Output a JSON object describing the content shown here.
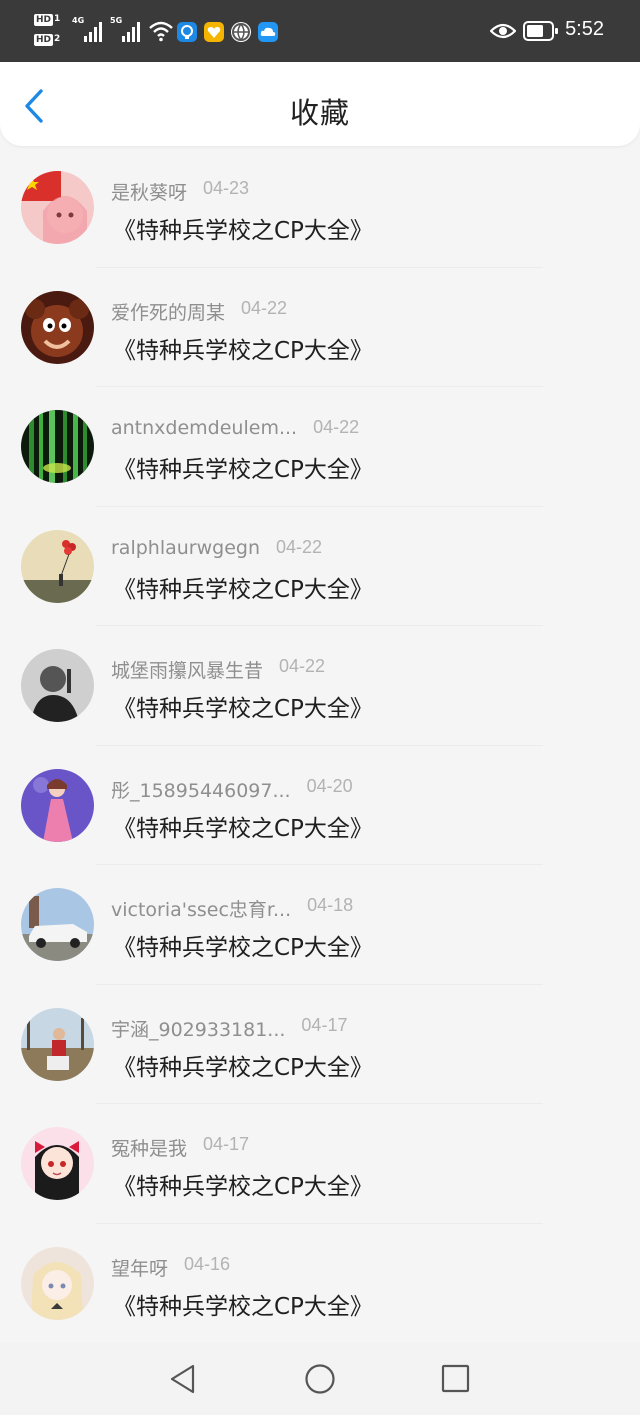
{
  "status_bar": {
    "time": "5:52",
    "sim1_badge": "HD",
    "sim1_num": "1",
    "sim2_badge": "HD",
    "sim2_num": "2",
    "net1_label": "4G",
    "net2_label": "5G",
    "icons": [
      "signal-4g-icon",
      "signal-5g-icon",
      "wifi-icon",
      "bulb-app-icon",
      "heart-app-icon",
      "globe-app-icon",
      "cloud-app-icon",
      "eye-icon",
      "battery-icon"
    ],
    "app_colors": {
      "bulb": "#1e88e5",
      "heart": "#f4b400",
      "globe": "#555555",
      "cloud": "#2196f3"
    }
  },
  "header": {
    "title": "收藏",
    "back_icon": "chevron-left-icon",
    "accent": "#1e88e5"
  },
  "favorites": [
    {
      "user": "是秋葵呀",
      "date": "04-23",
      "title": "《特种兵学校之CP大全》",
      "avatar": "avatar-anime-flag"
    },
    {
      "user": "爱作死的周某",
      "date": "04-22",
      "title": "《特种兵学校之CP大全》",
      "avatar": "avatar-cartoon-mouse"
    },
    {
      "user": "antnxdemdeulem...",
      "date": "04-22",
      "title": "《特种兵学校之CP大全》",
      "avatar": "avatar-green-bamboo"
    },
    {
      "user": "ralphlaurwgegn",
      "date": "04-22",
      "title": "《特种兵学校之CP大全》",
      "avatar": "avatar-balloons"
    },
    {
      "user": "城堡雨攥风暴生昔",
      "date": "04-22",
      "title": "《特种兵学校之CP大全》",
      "avatar": "avatar-man-bw"
    },
    {
      "user": "彤_15895446097...",
      "date": "04-20",
      "title": "《特种兵学校之CP大全》",
      "avatar": "avatar-pink-dress"
    },
    {
      "user": "victoria'ssec忠育r...",
      "date": "04-18",
      "title": "《特种兵学校之CP大全》",
      "avatar": "avatar-white-car"
    },
    {
      "user": "宇涵_902933181...",
      "date": "04-17",
      "title": "《特种兵学校之CP大全》",
      "avatar": "avatar-outdoor-person"
    },
    {
      "user": "冤种是我",
      "date": "04-17",
      "title": "《特种兵学校之CP大全》",
      "avatar": "avatar-anime-girl"
    },
    {
      "user": "望年呀",
      "date": "04-16",
      "title": "《特种兵学校之CP大全》",
      "avatar": "avatar-pale-anime"
    }
  ],
  "nav_bar": {
    "back": "triangle-back-icon",
    "home": "circle-home-icon",
    "recents": "square-recents-icon"
  }
}
